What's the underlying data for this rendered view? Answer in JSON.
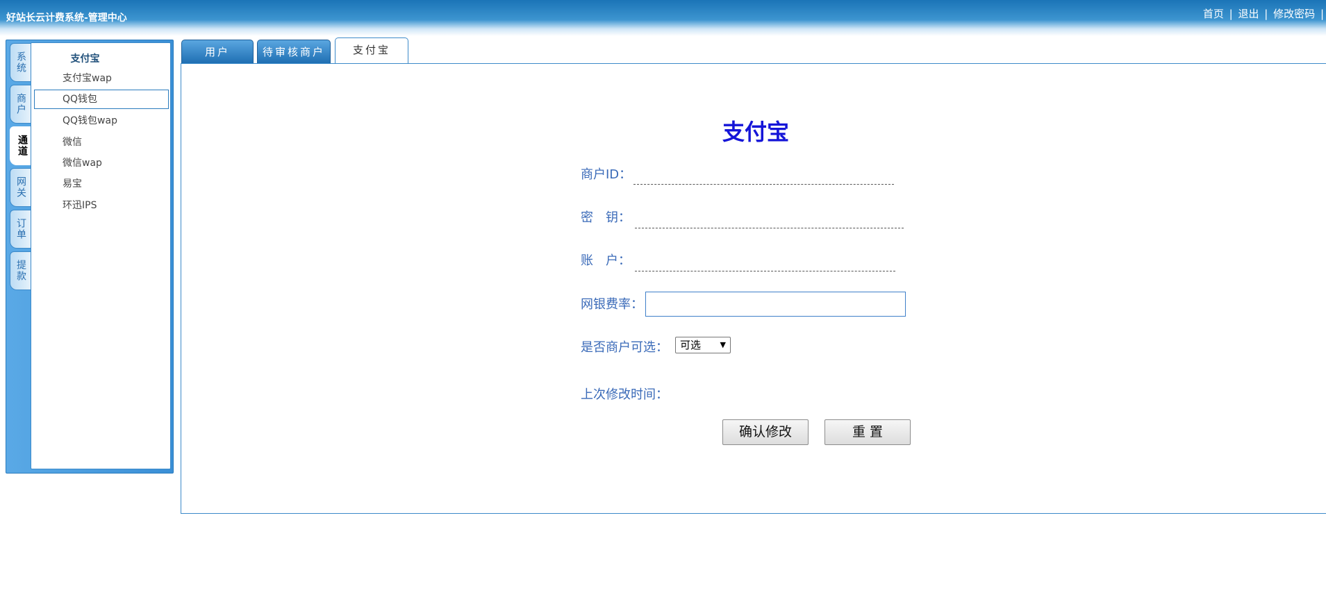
{
  "header": {
    "title": "好站长云计费系统-管理中心",
    "links": [
      "首页",
      "退出",
      "修改密码"
    ],
    "separator": "|"
  },
  "sidebar": {
    "vtabs": [
      {
        "label": "系统",
        "active": false
      },
      {
        "label": "商户",
        "active": false
      },
      {
        "label": "通道",
        "active": true
      },
      {
        "label": "网关",
        "active": false
      },
      {
        "label": "订单",
        "active": false
      },
      {
        "label": "提款",
        "active": false
      }
    ],
    "subnav_title": "支付宝",
    "items": [
      {
        "label": "支付宝wap",
        "selected": false
      },
      {
        "label": "QQ钱包",
        "selected": true
      },
      {
        "label": "QQ钱包wap",
        "selected": false
      },
      {
        "label": "微信",
        "selected": false
      },
      {
        "label": "微信wap",
        "selected": false
      },
      {
        "label": "易宝",
        "selected": false
      },
      {
        "label": "环迅IPS",
        "selected": false
      }
    ]
  },
  "tabs": [
    {
      "label": "用户",
      "active": false
    },
    {
      "label": "待审核商户",
      "active": false
    },
    {
      "label": "支付宝",
      "active": true
    }
  ],
  "form": {
    "title": "支付宝",
    "merchant_id_label": "商户ID：",
    "merchant_id_value": "",
    "key_label": "密　钥：",
    "key_value": "",
    "account_label": "账　户：",
    "account_value": "",
    "rate_label": "网银费率：",
    "rate_value": "",
    "selectable_label": "是否商户可选：",
    "selectable_value": "可选",
    "last_modified_label": "上次修改时间：",
    "last_modified_value": "",
    "confirm_button": "确认修改",
    "reset_button": "重 置"
  },
  "colors": {
    "header_blue": "#1b74b7",
    "title_blue": "#1515d8",
    "label_blue": "#3a6ab8",
    "panel_blue": "#3a8fd6"
  }
}
